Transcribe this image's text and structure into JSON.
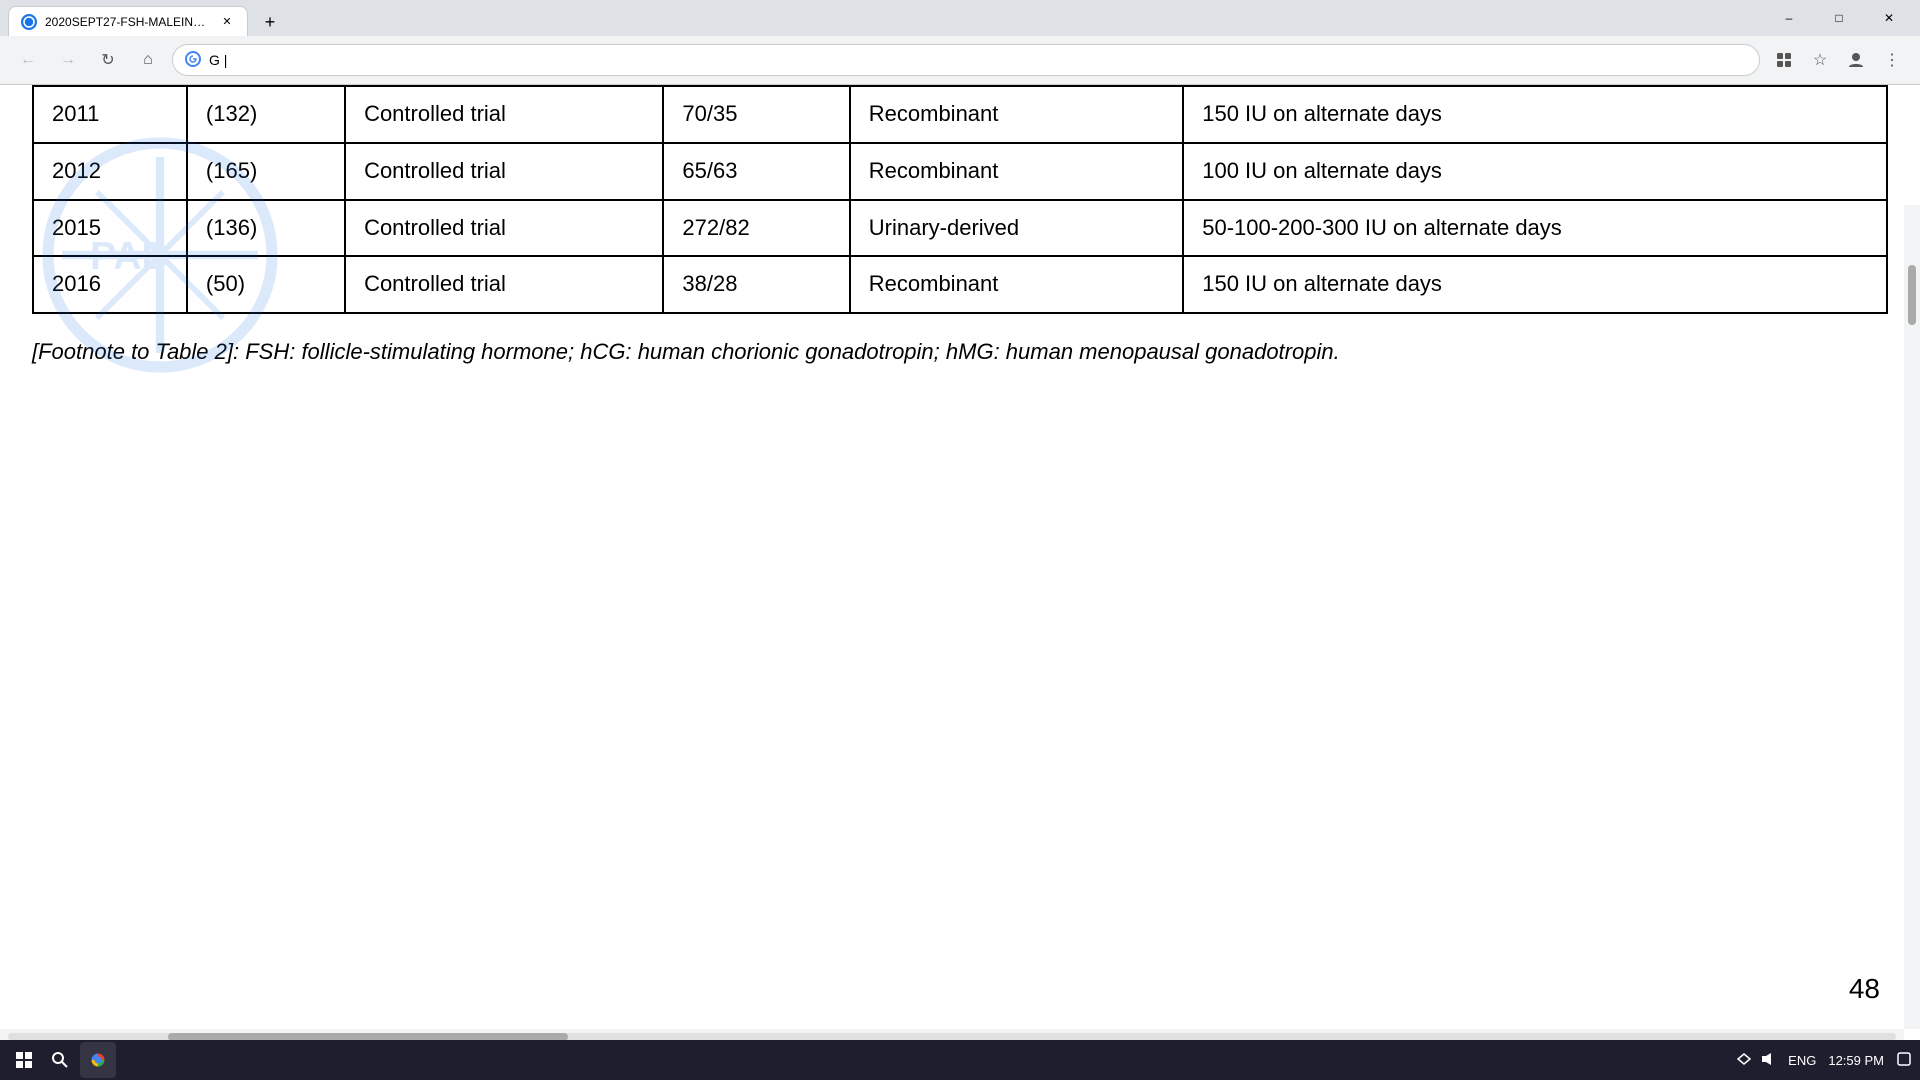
{
  "browser": {
    "tab_title": "2020SEPT27-FSH-MALEINFERTIL...",
    "address": "G",
    "address_placeholder": "G |"
  },
  "table": {
    "rows": [
      {
        "year": "2011",
        "sample": "(132)",
        "study_type": "Controlled trial",
        "ratio": "70/35",
        "fsh_type": "Recombinant",
        "dose": "150 IU on alternate days"
      },
      {
        "year": "2012",
        "sample": "(165)",
        "study_type": "Controlled trial",
        "ratio": "65/63",
        "fsh_type": "Recombinant",
        "dose": "100 IU on alternate days"
      },
      {
        "year": "2015",
        "sample": "(136)",
        "study_type": "Controlled trial",
        "ratio": "272/82",
        "fsh_type": "Urinary-derived",
        "dose": "50-100-200-300 IU on alternate days"
      },
      {
        "year": "2016",
        "sample": "(50)",
        "study_type": "Controlled trial",
        "ratio": "38/28",
        "fsh_type": "Recombinant",
        "dose": "150 IU on alternate days"
      }
    ]
  },
  "footnote": {
    "text": "[Footnote to Table 2]: FSH: follicle-stimulating hormone; hCG: human chorionic gonadotropin; hMG: human menopausal gonadotropin."
  },
  "page_number": "48",
  "taskbar": {
    "time": "12:59 PM",
    "language": "ENG"
  }
}
